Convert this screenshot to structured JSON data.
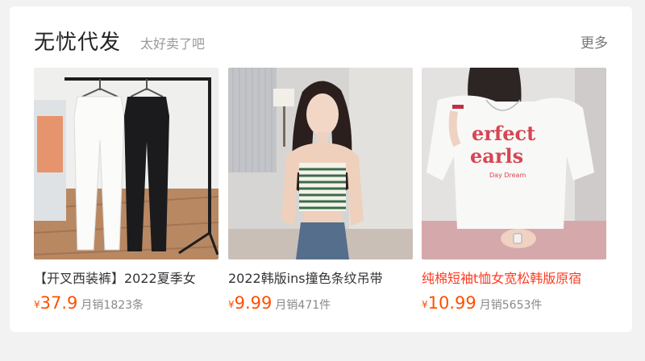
{
  "section": {
    "title": "无忧代发",
    "subtitle": "太好卖了吧",
    "more_label": "更多"
  },
  "products": [
    {
      "name": "【开叉西装裤】2022夏季女",
      "currency": "¥",
      "price": "37.9",
      "sales": "月销1823条",
      "image": "white-and-black-trousers-on-rack"
    },
    {
      "name": "2022韩版ins撞色条纹吊带",
      "currency": "¥",
      "price": "9.99",
      "sales": "月销471件",
      "image": "woman-in-striped-camisole"
    },
    {
      "name": "纯棉短袖t恤女宽松韩版原宿",
      "currency": "¥",
      "price": "10.99",
      "sales": "月销5653件",
      "image": "woman-in-printed-white-tshirt"
    }
  ],
  "colors": {
    "price": "#ff5000",
    "highlight_name": "#ff3b1f"
  }
}
